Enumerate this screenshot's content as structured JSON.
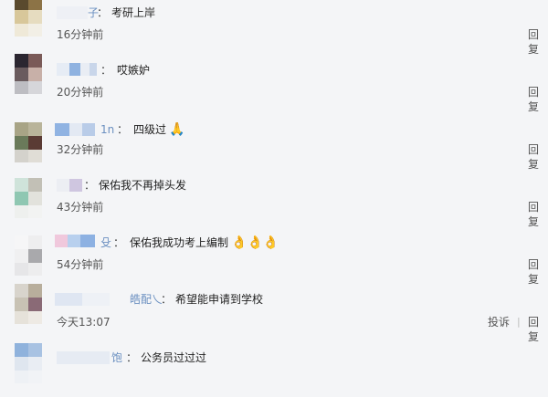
{
  "comments": [
    {
      "name_fragment": "子",
      "colon": "：",
      "text": "考研上岸",
      "emojis": "",
      "time": "16分钟前",
      "actions": [
        "回复"
      ]
    },
    {
      "name_fragment": "",
      "colon": "：",
      "text": "哎嫉妒",
      "emojis": "",
      "time": "20分钟前",
      "actions": [
        "回复"
      ]
    },
    {
      "name_fragment": "1n",
      "colon": "：",
      "text": "四级过",
      "emojis": "🙏",
      "time": "32分钟前",
      "actions": [
        "回复"
      ]
    },
    {
      "name_fragment": "",
      "colon": "：",
      "text": "保佑我不再掉头发",
      "emojis": "",
      "time": "43分钟前",
      "actions": [
        "回复"
      ]
    },
    {
      "name_fragment": "殳",
      "colon": "：",
      "text": "保佑我成功考上编制",
      "emojis": "👌👌👌",
      "time": "54分钟前",
      "actions": [
        "回复"
      ]
    },
    {
      "name_fragment": "皓配乀",
      "colon": "：",
      "text": "希望能申请到学校",
      "emojis": "",
      "time": "今天13:07",
      "actions": [
        "投诉",
        "回复"
      ],
      "separator": "|"
    },
    {
      "name_fragment": "饱",
      "colon": "：",
      "text": "公务员过过过",
      "emojis": "",
      "time": "",
      "actions": []
    }
  ]
}
